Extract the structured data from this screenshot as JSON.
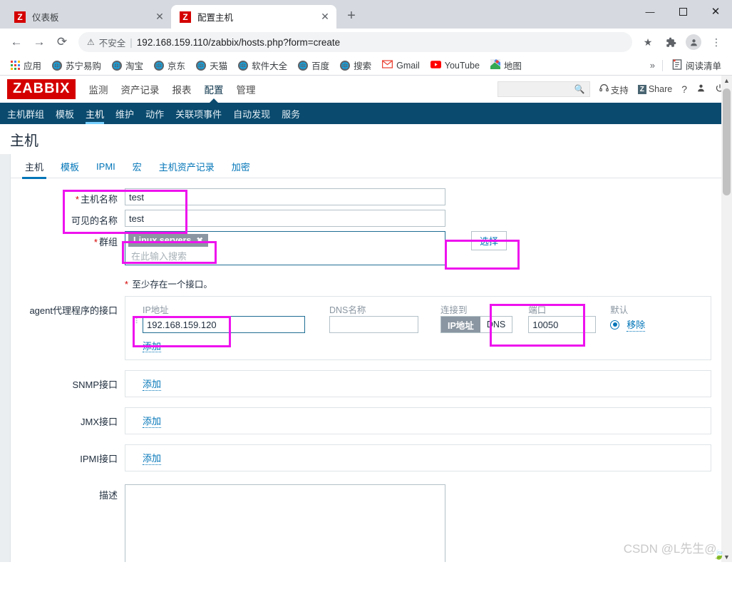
{
  "browser": {
    "tabs": [
      {
        "title": "仪表板",
        "favicon": "Z",
        "active": false
      },
      {
        "title": "配置主机",
        "favicon": "Z",
        "active": true
      }
    ],
    "new_tab_label": "+",
    "window_controls": {
      "minimize": "—",
      "maximize": "▢",
      "close": "✕"
    },
    "nav": {
      "back": "←",
      "forward": "→",
      "reload": "⟳"
    },
    "omnibox": {
      "security_icon": "warning-triangle-icon",
      "security_label": "不安全",
      "separator": "|",
      "url": "192.168.159.110/zabbix/hosts.php?form=create",
      "star_icon": "★"
    },
    "toolbar_icons": [
      "bookmark-star-icon",
      "extensions-puzzle-icon",
      "profile-avatar-icon",
      "chrome-menu-icon"
    ],
    "bookmarks": [
      {
        "label": "应用",
        "icon": "apps-grid-icon"
      },
      {
        "label": "苏宁易购",
        "icon": "globe-icon"
      },
      {
        "label": "淘宝",
        "icon": "globe-icon"
      },
      {
        "label": "京东",
        "icon": "globe-icon"
      },
      {
        "label": "天猫",
        "icon": "globe-icon"
      },
      {
        "label": "软件大全",
        "icon": "globe-icon"
      },
      {
        "label": "百度",
        "icon": "globe-icon"
      },
      {
        "label": "搜索",
        "icon": "globe-icon"
      },
      {
        "label": "Gmail",
        "icon": "gmail-icon"
      },
      {
        "label": "YouTube",
        "icon": "youtube-icon"
      },
      {
        "label": "地图",
        "icon": "maps-icon"
      }
    ],
    "bookmarks_overflow": "»",
    "reading_list": {
      "label": "阅读清单",
      "icon": "reading-list-icon"
    }
  },
  "zabbix": {
    "logo": "ZABBIX",
    "brand_color": "#d40000",
    "menu": [
      {
        "label": "监测",
        "active": false
      },
      {
        "label": "资产记录",
        "active": false
      },
      {
        "label": "报表",
        "active": false
      },
      {
        "label": "配置",
        "active": true
      },
      {
        "label": "管理",
        "active": false
      }
    ],
    "header_right": {
      "search_value": "",
      "search_icon": "search-icon",
      "support": {
        "label": "支持",
        "icon": "headset-icon"
      },
      "share": {
        "label": "Share",
        "badge": "Z"
      },
      "help_icon": "?",
      "user_icon": "person-icon",
      "signout_icon": "power-icon"
    },
    "subnav": [
      {
        "label": "主机群组",
        "active": false
      },
      {
        "label": "模板",
        "active": false
      },
      {
        "label": "主机",
        "active": true
      },
      {
        "label": "维护",
        "active": false
      },
      {
        "label": "动作",
        "active": false
      },
      {
        "label": "关联项事件",
        "active": false
      },
      {
        "label": "自动发现",
        "active": false
      },
      {
        "label": "服务",
        "active": false
      }
    ],
    "page_title": "主机",
    "tabs": [
      {
        "label": "主机",
        "active": true
      },
      {
        "label": "模板",
        "active": false
      },
      {
        "label": "IPMI",
        "active": false
      },
      {
        "label": "宏",
        "active": false
      },
      {
        "label": "主机资产记录",
        "active": false
      },
      {
        "label": "加密",
        "active": false
      }
    ],
    "form": {
      "hostname": {
        "label": "主机名称",
        "required": true,
        "value": "test"
      },
      "visiblename": {
        "label": "可见的名称",
        "required": false,
        "value": "test"
      },
      "groups": {
        "label": "群组",
        "required": true,
        "chips": [
          {
            "text": "Linux servers",
            "remove": "✖"
          }
        ],
        "placeholder": "在此输入搜索",
        "select_button": "选择"
      },
      "interface_hint": {
        "required_mark": "*",
        "text": "至少存在一个接口。"
      },
      "agent_interface": {
        "label": "agent代理程序的接口",
        "columns": {
          "ip": "IP地址",
          "dns": "DNS名称",
          "connect_to": "连接到",
          "port": "端口",
          "default": "默认"
        },
        "rows": [
          {
            "ip": "192.168.159.120",
            "dns": "",
            "connect_to_options": [
              "IP地址",
              "DNS"
            ],
            "connect_to_selected": "IP地址",
            "port": "10050",
            "default_selected": true,
            "remove_label": "移除"
          }
        ],
        "add_label": "添加"
      },
      "snmp_interface": {
        "label": "SNMP接口",
        "add_label": "添加"
      },
      "jmx_interface": {
        "label": "JMX接口",
        "add_label": "添加"
      },
      "ipmi_interface": {
        "label": "IPMI接口",
        "add_label": "添加"
      },
      "description": {
        "label": "描述",
        "value": ""
      }
    },
    "annotation_color": "#ee12ee"
  },
  "watermark": {
    "text": "CSDN @L先生@..",
    "leaf_icon": "leaf-icon"
  }
}
